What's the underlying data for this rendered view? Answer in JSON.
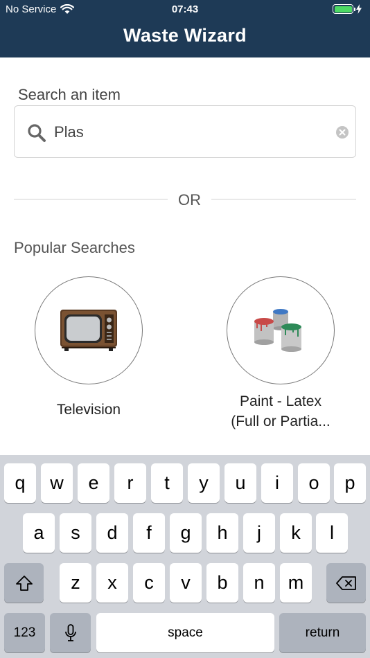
{
  "status_bar": {
    "carrier": "No Service",
    "time": "07:43"
  },
  "header": {
    "title": "Waste Wizard"
  },
  "search": {
    "label": "Search an item",
    "value": "Plas"
  },
  "divider": {
    "or_text": "OR"
  },
  "popular": {
    "heading": "Popular Searches",
    "items": [
      {
        "label": "Television",
        "icon": "television-icon"
      },
      {
        "label_line1": "Paint - Latex",
        "label_line2": "(Full or Partia...",
        "icon": "paint-cans-icon"
      }
    ]
  },
  "keyboard": {
    "row1": [
      "q",
      "w",
      "e",
      "r",
      "t",
      "y",
      "u",
      "i",
      "o",
      "p"
    ],
    "row2": [
      "a",
      "s",
      "d",
      "f",
      "g",
      "h",
      "j",
      "k",
      "l"
    ],
    "row3": [
      "z",
      "x",
      "c",
      "v",
      "b",
      "n",
      "m"
    ],
    "numbers_key": "123",
    "space_key": "space",
    "return_key": "return"
  },
  "colors": {
    "header_bg": "#1e3a56",
    "battery": "#4cd964",
    "keyboard_bg": "#d1d4da"
  }
}
